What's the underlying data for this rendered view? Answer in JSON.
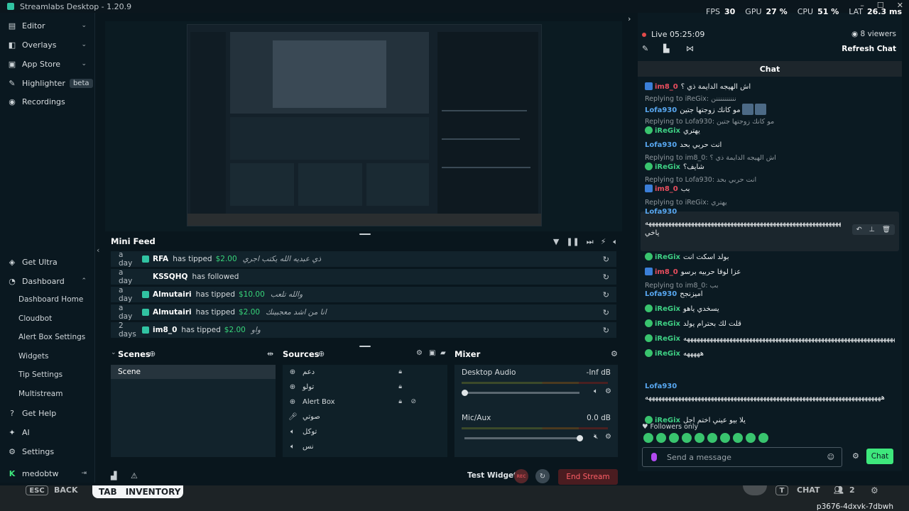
{
  "app": {
    "title": "Streamlabs Desktop - 1.20.9",
    "window_controls": [
      "–",
      "☐",
      "✕"
    ]
  },
  "stats": [
    {
      "label": "FPS",
      "value": "30"
    },
    {
      "label": "GPU",
      "value": "27 %"
    },
    {
      "label": "CPU",
      "value": "51 %"
    },
    {
      "label": "LAT",
      "value": "26.3 ms"
    }
  ],
  "sidebar": {
    "top": [
      {
        "label": "Editor",
        "icon": "layout-icon"
      },
      {
        "label": "Overlays",
        "icon": "overlay-icon"
      },
      {
        "label": "App Store",
        "icon": "store-icon"
      },
      {
        "label": "Highlighter",
        "icon": "highlighter-icon",
        "badge": "beta"
      },
      {
        "label": "Recordings",
        "icon": "record-icon"
      }
    ],
    "bottom": {
      "get_ultra": "Get Ultra",
      "dashboard": "Dashboard",
      "dashboard_items": [
        "Dashboard Home",
        "Cloudbot",
        "Alert Box Settings",
        "Widgets",
        "Tip Settings",
        "Multistream"
      ],
      "get_help": "Get Help",
      "ai": "AI",
      "settings": "Settings",
      "user": "medobtw"
    }
  },
  "minifeed": {
    "title": "Mini Feed",
    "rows": [
      {
        "when": "a day",
        "who": "RFA",
        "action": "has tipped",
        "amount": "$2.00",
        "message": "ذي عبديه الله يكتب اجري"
      },
      {
        "when": "a day",
        "who": "KSSQHQ",
        "action": "has followed",
        "amount": "",
        "message": ""
      },
      {
        "when": "a day",
        "who": "Almutairi",
        "action": "has tipped",
        "amount": "$10.00",
        "message": "والله تلعب"
      },
      {
        "when": "a day",
        "who": "Almutairi",
        "action": "has tipped",
        "amount": "$2.00",
        "message": "انا من اشد معجبينك"
      },
      {
        "when": "2 days",
        "who": "im8_0",
        "action": "has tipped",
        "amount": "$2.00",
        "message": "واو"
      }
    ]
  },
  "scenes": {
    "title": "Scenes",
    "items": [
      "Scene"
    ]
  },
  "sources": {
    "title": "Sources",
    "items": [
      {
        "label": "دعم",
        "icon": "globe-icon"
      },
      {
        "label": "تولو",
        "icon": "globe-icon"
      },
      {
        "label": "Alert Box",
        "icon": "globe-icon"
      },
      {
        "label": "صوتي",
        "icon": "mic-icon"
      },
      {
        "label": "توكل",
        "icon": "speaker-icon"
      },
      {
        "label": "نس",
        "icon": "speaker-icon"
      }
    ]
  },
  "mixer": {
    "title": "Mixer",
    "channels": [
      {
        "name": "Desktop Audio",
        "db": "-Inf dB",
        "level": 0.0
      },
      {
        "name": "Mic/Aux",
        "db": "0.0 dB",
        "level": 1.0
      }
    ]
  },
  "footer": {
    "test_widgets": "Test Widgets",
    "rec": "REC",
    "end_stream": "End Stream"
  },
  "game_overlay": {
    "esc": "ESC",
    "back": "BACK",
    "tab": "TAB",
    "inventory": "INVENTORY",
    "chat_key": "T",
    "chat": "CHAT",
    "party_count": "2",
    "session_id": "p3676-4dxvk-7dbwh"
  },
  "chat": {
    "live_time": "Live 05:25:09",
    "viewers": "8 viewers",
    "refresh": "Refresh Chat",
    "header": "Chat",
    "messages": [
      {
        "reply": "",
        "user": "im8_0",
        "color": "red",
        "badge": "mod",
        "text": "اش الهيجه الدايمة ذي ؟"
      },
      {
        "reply": "Replying to iReGix: ننننننننننن",
        "user": "Lofa930",
        "color": "blue",
        "badge": "",
        "text": "مو كانك زوجتها جتين"
      },
      {
        "reply": "Replying to Lofa930: مو كانك زوجتها جتين",
        "user": "iReGix",
        "color": "green",
        "badge": "sub",
        "text": "يهتري"
      },
      {
        "reply": "",
        "user": "Lofa930",
        "color": "blue",
        "badge": "",
        "text": "انت حربي بحد"
      },
      {
        "reply": "Replying to im8_0: اش الهيجه الدايمة ذي ؟",
        "user": "iReGix",
        "color": "green",
        "badge": "sub",
        "text": "شايف؟"
      },
      {
        "reply": "Replying to Lofa930: انت حربي بحد",
        "user": "im8_0",
        "color": "red",
        "badge": "mod",
        "text": "بب"
      },
      {
        "reply": "Replying to iReGix: يهتري",
        "user": "Lofa930",
        "color": "blue",
        "badge": "",
        "text": "ههههههههههههههههههههههههههههههههههههههههههههههههههههههههههههههه ياخي"
      },
      {
        "reply": "",
        "user": "iReGix",
        "color": "green",
        "badge": "sub",
        "text": "بولد اسكت انت"
      },
      {
        "reply": "",
        "user": "im8_0",
        "color": "red",
        "badge": "mod",
        "text": "عزا لوفا حربيه برسو"
      },
      {
        "reply": "Replying to im8_0: بب",
        "user": "Lofa930",
        "color": "blue",
        "badge": "",
        "text": "اميزنجح"
      },
      {
        "reply": "",
        "user": "iReGix",
        "color": "green",
        "badge": "sub",
        "text": "يسخدي ياهو"
      },
      {
        "reply": "",
        "user": "iReGix",
        "color": "green",
        "badge": "sub",
        "text": "قلت لك بحترام يولد"
      },
      {
        "reply": "",
        "user": "iReGix",
        "color": "green",
        "badge": "sub",
        "text": "ههههههههههههههههههههههههههههههههههههههههههههههههههههههههههههههههههه"
      },
      {
        "reply": "",
        "user": "iReGix",
        "color": "green",
        "badge": "sub",
        "text": "هههههه"
      },
      {
        "reply": "",
        "user": "Lofa930",
        "color": "blue",
        "badge": "",
        "text": "ههههههههههههههههههههههههههههههههههههههههههههههههههههههههههههههههههههههههه"
      },
      {
        "reply": "",
        "user": "iReGix",
        "color": "green",
        "badge": "sub",
        "text": "يلا بيو عيني اختم اجل"
      }
    ],
    "followers_only": "Followers only",
    "placeholder": "Send a message",
    "send": "Chat"
  },
  "colors": {
    "accent": "#31c3a2",
    "chat_send": "#3ee77c",
    "end_stream": "#ff5e66",
    "live": "#e24a4a"
  }
}
